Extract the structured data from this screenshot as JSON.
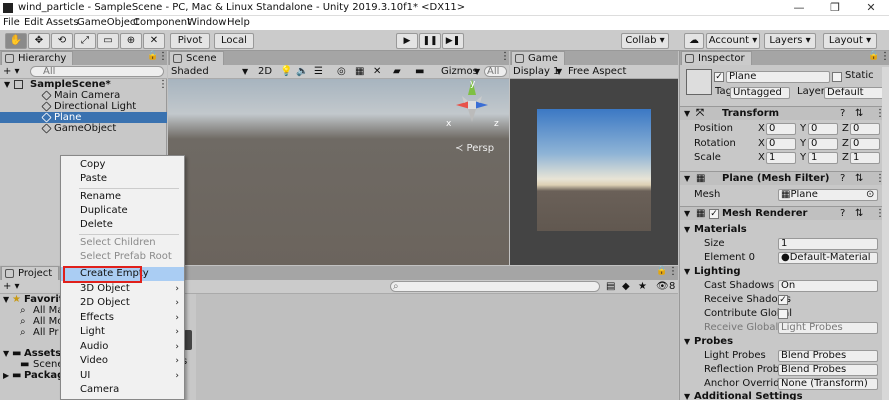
{
  "window": {
    "title": "wind_particle - SampleScene - PC, Mac & Linux Standalone - Unity 2019.3.10f1* <DX11>",
    "minimize": "—",
    "restore": "❐",
    "close": "✕"
  },
  "menu": [
    "File",
    "Edit",
    "Assets",
    "GameObject",
    "Component",
    "Window",
    "Help"
  ],
  "toolbar": {
    "pivot": "Pivot",
    "local": "Local",
    "play": "▶",
    "pause": "❚❚",
    "step": "▶❚",
    "collab": "Collab ▾",
    "account": "Account ▾",
    "layers": "Layers ▾",
    "layout": "Layout ▾"
  },
  "hierarchy": {
    "tab": "Hierarchy",
    "add": "+ ▾",
    "search_placeholder": "All",
    "scene": "SampleScene*",
    "items": [
      "Main Camera",
      "Directional Light",
      "Plane",
      "GameObject"
    ]
  },
  "scene": {
    "tab": "Scene",
    "shading": "Shaded",
    "mode2d": "2D",
    "gizmos": "Gizmos",
    "search_placeholder": "All",
    "persp": "≺ Persp",
    "axis_x": "x",
    "axis_z": "z",
    "axis_y": "y"
  },
  "game": {
    "tab": "Game",
    "display": "Display 1",
    "aspect": "Free Aspect"
  },
  "inspector": {
    "tab": "Inspector",
    "object_name": "Plane",
    "static": "Static",
    "tag_label": "Tag",
    "tag_value": "Untagged",
    "layer_label": "Layer",
    "layer_value": "Default",
    "transform": {
      "title": "Transform",
      "rows": [
        {
          "label": "Position",
          "x": "0",
          "y": "0",
          "z": "0"
        },
        {
          "label": "Rotation",
          "x": "0",
          "y": "0",
          "z": "0"
        },
        {
          "label": "Scale",
          "x": "1",
          "y": "1",
          "z": "1"
        }
      ]
    },
    "mesh_filter": {
      "title": "Plane (Mesh Filter)",
      "mesh_label": "Mesh",
      "mesh_value": "Plane"
    },
    "mesh_renderer": {
      "title": "Mesh Renderer",
      "materials": "Materials",
      "size_label": "Size",
      "size_value": "1",
      "element_label": "Element 0",
      "element_value": "Default-Material",
      "lighting": "Lighting",
      "cast_shadows_label": "Cast Shadows",
      "cast_shadows_value": "On",
      "receive_shadows_label": "Receive Shadows",
      "contribute_gi_label": "Contribute Global",
      "receive_gi_label": "Receive Global Ill",
      "receive_gi_value": "Light Probes",
      "probes": "Probes",
      "light_probes_label": "Light Probes",
      "light_probes_value": "Blend Probes",
      "reflection_probes_label": "Reflection Probes",
      "reflection_probes_value": "Blend Probes",
      "anchor_override_label": "Anchor Override",
      "anchor_override_value": "None (Transform)",
      "additional_settings": "Additional Settings"
    }
  },
  "project": {
    "tab": "Project",
    "add": "+ ▾",
    "favorites": "Favorites",
    "fav_items": [
      "All Ma",
      "All Mo",
      "All Pr"
    ],
    "assets": "Assets",
    "asset_items": [
      "Scene"
    ],
    "packages": "Packag",
    "count": "8",
    "right_label": "s"
  },
  "context_menu": {
    "items": [
      {
        "label": "Copy",
        "disabled": false
      },
      {
        "label": "Paste",
        "disabled": false
      },
      {
        "label": "Rename",
        "disabled": false
      },
      {
        "label": "Duplicate",
        "disabled": false
      },
      {
        "label": "Delete",
        "disabled": false
      },
      {
        "label": "Select Children",
        "disabled": true
      },
      {
        "label": "Select Prefab Root",
        "disabled": true
      },
      {
        "label": "Create Empty",
        "disabled": false,
        "highlighted": true
      },
      {
        "label": "3D Object",
        "submenu": true
      },
      {
        "label": "2D Object",
        "submenu": true
      },
      {
        "label": "Effects",
        "submenu": true
      },
      {
        "label": "Light",
        "submenu": true
      },
      {
        "label": "Audio",
        "submenu": true
      },
      {
        "label": "Video",
        "submenu": true
      },
      {
        "label": "UI",
        "submenu": true
      },
      {
        "label": "Camera",
        "submenu": false
      }
    ],
    "arrow": "›"
  }
}
